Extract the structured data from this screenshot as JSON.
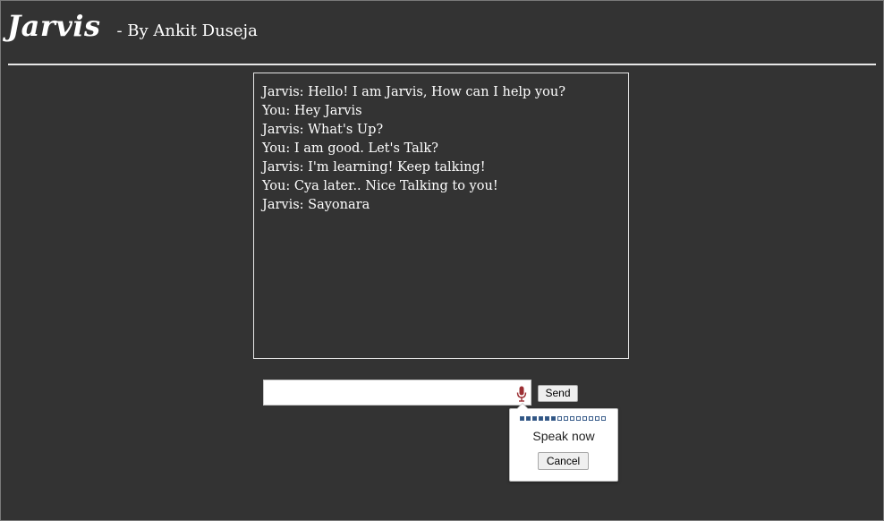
{
  "header": {
    "title": "Jarvis",
    "subtitle": "- By Ankit Duseja"
  },
  "chat": {
    "messages": [
      "Jarvis: Hello! I am Jarvis, How can I help you?",
      "You: Hey Jarvis",
      "Jarvis: What's Up?",
      "You: I am good. Let's Talk?",
      "Jarvis: I'm learning! Keep talking!",
      "You: Cya later.. Nice Talking to you!",
      "Jarvis: Sayonara"
    ]
  },
  "composer": {
    "input_value": "",
    "placeholder": "",
    "mic_icon": "microphone-icon",
    "send_label": "Send"
  },
  "speech_popup": {
    "level": 0.45,
    "speak_label": "Speak now",
    "cancel_label": "Cancel"
  },
  "colors": {
    "background": "#333333",
    "text": "#ffffff",
    "mic": "#9b2e32",
    "meter": "#2f5583"
  }
}
